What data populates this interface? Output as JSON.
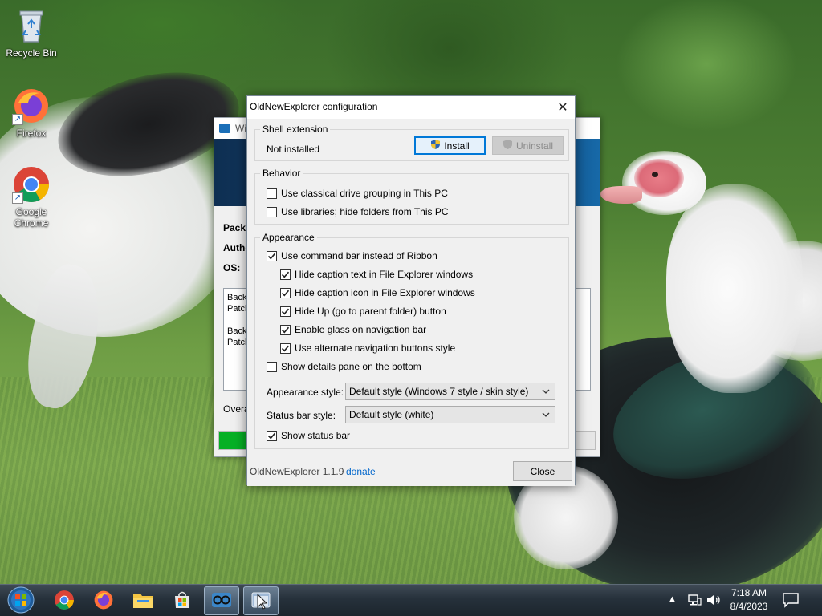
{
  "desktop": {
    "icons": [
      {
        "label": "Recycle Bin",
        "icon": "recycle-bin-icon"
      },
      {
        "label": "Firefox",
        "icon": "firefox-icon"
      },
      {
        "label": "Google Chrome",
        "icon": "chrome-icon"
      }
    ]
  },
  "background_window": {
    "title": "Wi",
    "labels": [
      "Packa",
      "Autho",
      "OS:"
    ],
    "log_text": "Backu\nPatch\n\nBacku\nPatch",
    "footer_label": "Overa",
    "progress": 0.14
  },
  "dialog": {
    "title": "OldNewExplorer configuration",
    "shell_extension": {
      "group_label": "Shell extension",
      "status": "Not installed",
      "install_label": "Install",
      "uninstall_label": "Uninstall"
    },
    "behavior": {
      "group_label": "Behavior",
      "options": [
        {
          "label": "Use classical drive grouping in This PC",
          "checked": false
        },
        {
          "label": "Use libraries; hide folders from This PC",
          "checked": false
        }
      ]
    },
    "appearance": {
      "group_label": "Appearance",
      "options": [
        {
          "label": "Use command bar instead of Ribbon",
          "checked": true
        },
        {
          "label": "Hide caption text in File Explorer windows",
          "checked": true
        },
        {
          "label": "Hide caption icon in File Explorer windows",
          "checked": true
        },
        {
          "label": "Hide Up (go to parent folder) button",
          "checked": true
        },
        {
          "label": "Enable glass on navigation bar",
          "checked": true
        },
        {
          "label": "Use alternate navigation buttons style",
          "checked": true
        },
        {
          "label": "Show details pane on the bottom",
          "checked": false
        }
      ],
      "appearance_style_label": "Appearance style:",
      "appearance_style_value": "Default style (Windows 7 style / skin style)",
      "status_bar_style_label": "Status bar style:",
      "status_bar_style_value": "Default style (white)",
      "show_status_bar": {
        "label": "Show status bar",
        "checked": true
      }
    },
    "footer": {
      "version": "OldNewExplorer 1.1.9",
      "donate": "donate",
      "close_label": "Close"
    }
  },
  "taskbar": {
    "items": [
      {
        "icon": "start-orb-icon"
      },
      {
        "icon": "chrome-icon"
      },
      {
        "icon": "firefox-icon"
      },
      {
        "icon": "file-explorer-icon"
      },
      {
        "icon": "store-icon"
      },
      {
        "icon": "oldnewexplorer-icon"
      },
      {
        "icon": "explorer-window-icon"
      }
    ],
    "clock_time": "7:18 AM",
    "clock_date": "8/4/2023"
  },
  "colors": {
    "accent": "#0078d7",
    "link": "#0066cc",
    "progress_fill": "#06b025"
  }
}
